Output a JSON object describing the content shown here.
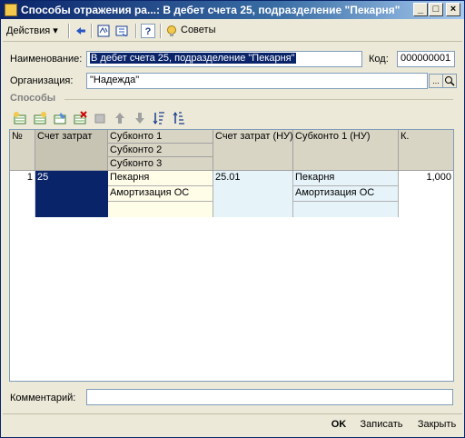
{
  "window": {
    "title": "Способы отражения ра...: В дебет счета 25, подразделение \"Пекарня\"",
    "buttons": {
      "minimize": "_",
      "maximize": "□",
      "close": "×"
    }
  },
  "toolbar": {
    "actions_label": "Действия ▾",
    "advice_label": "Советы",
    "help_label": "?"
  },
  "form": {
    "name_label": "Наименование:",
    "name_value": "В дебет счета 25, подразделение \"Пекарня\"",
    "code_label": "Код:",
    "code_value": "000000001",
    "org_label": "Организация:",
    "org_value": "\"Надежда\"",
    "org_ellipsis": "...",
    "section_title": "Способы",
    "comment_label": "Комментарий:",
    "comment_value": ""
  },
  "grid": {
    "columns": {
      "n": "№",
      "cost_account": "Счет затрат",
      "subconto1": "Субконто 1",
      "subconto2": "Субконто 2",
      "subconto3": "Субконто 3",
      "cost_account_nu": "Счет затрат (НУ)",
      "subconto1_nu": "Субконто 1 (НУ)",
      "k": "К."
    },
    "rows": [
      {
        "n": "1",
        "cost_account": "25",
        "subconto1": "Пекарня",
        "subconto2": "Амортизация ОС",
        "subconto3": "",
        "cost_account_nu": "25.01",
        "subconto1_nu": "Пекарня",
        "subconto2_nu": "Амортизация ОС",
        "k": "1,000"
      }
    ]
  },
  "footer": {
    "ok_label": "OK",
    "save_label": "Записать",
    "close_label": "Закрыть"
  },
  "colors": {
    "title_bar": "#0a246a",
    "window_bg": "#ece9d8",
    "selection": "#0a246a",
    "row_yellow": "#fffde8",
    "row_blue": "#e6f4fa"
  }
}
